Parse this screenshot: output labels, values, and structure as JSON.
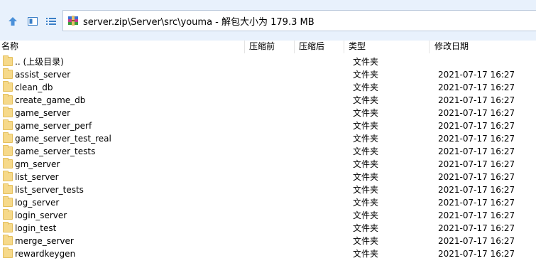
{
  "toolbar": {
    "path": "server.zip\\Server\\src\\youma - 解包大小为 179.3 MB"
  },
  "columns": {
    "name": "名称",
    "before": "压缩前",
    "after": "压缩后",
    "type": "类型",
    "date": "修改日期"
  },
  "rows": [
    {
      "name": ".. (上级目录)",
      "type": "文件夹",
      "date": ""
    },
    {
      "name": "assist_server",
      "type": "文件夹",
      "date": "2021-07-17 16:27"
    },
    {
      "name": "clean_db",
      "type": "文件夹",
      "date": "2021-07-17 16:27"
    },
    {
      "name": "create_game_db",
      "type": "文件夹",
      "date": "2021-07-17 16:27"
    },
    {
      "name": "game_server",
      "type": "文件夹",
      "date": "2021-07-17 16:27"
    },
    {
      "name": "game_server_perf",
      "type": "文件夹",
      "date": "2021-07-17 16:27"
    },
    {
      "name": "game_server_test_real",
      "type": "文件夹",
      "date": "2021-07-17 16:27"
    },
    {
      "name": "game_server_tests",
      "type": "文件夹",
      "date": "2021-07-17 16:27"
    },
    {
      "name": "gm_server",
      "type": "文件夹",
      "date": "2021-07-17 16:27"
    },
    {
      "name": "list_server",
      "type": "文件夹",
      "date": "2021-07-17 16:27"
    },
    {
      "name": "list_server_tests",
      "type": "文件夹",
      "date": "2021-07-17 16:27"
    },
    {
      "name": "log_server",
      "type": "文件夹",
      "date": "2021-07-17 16:27"
    },
    {
      "name": "login_server",
      "type": "文件夹",
      "date": "2021-07-17 16:27"
    },
    {
      "name": "login_test",
      "type": "文件夹",
      "date": "2021-07-17 16:27"
    },
    {
      "name": "merge_server",
      "type": "文件夹",
      "date": "2021-07-17 16:27"
    },
    {
      "name": "rewardkeygen",
      "type": "文件夹",
      "date": "2021-07-17 16:27"
    }
  ]
}
